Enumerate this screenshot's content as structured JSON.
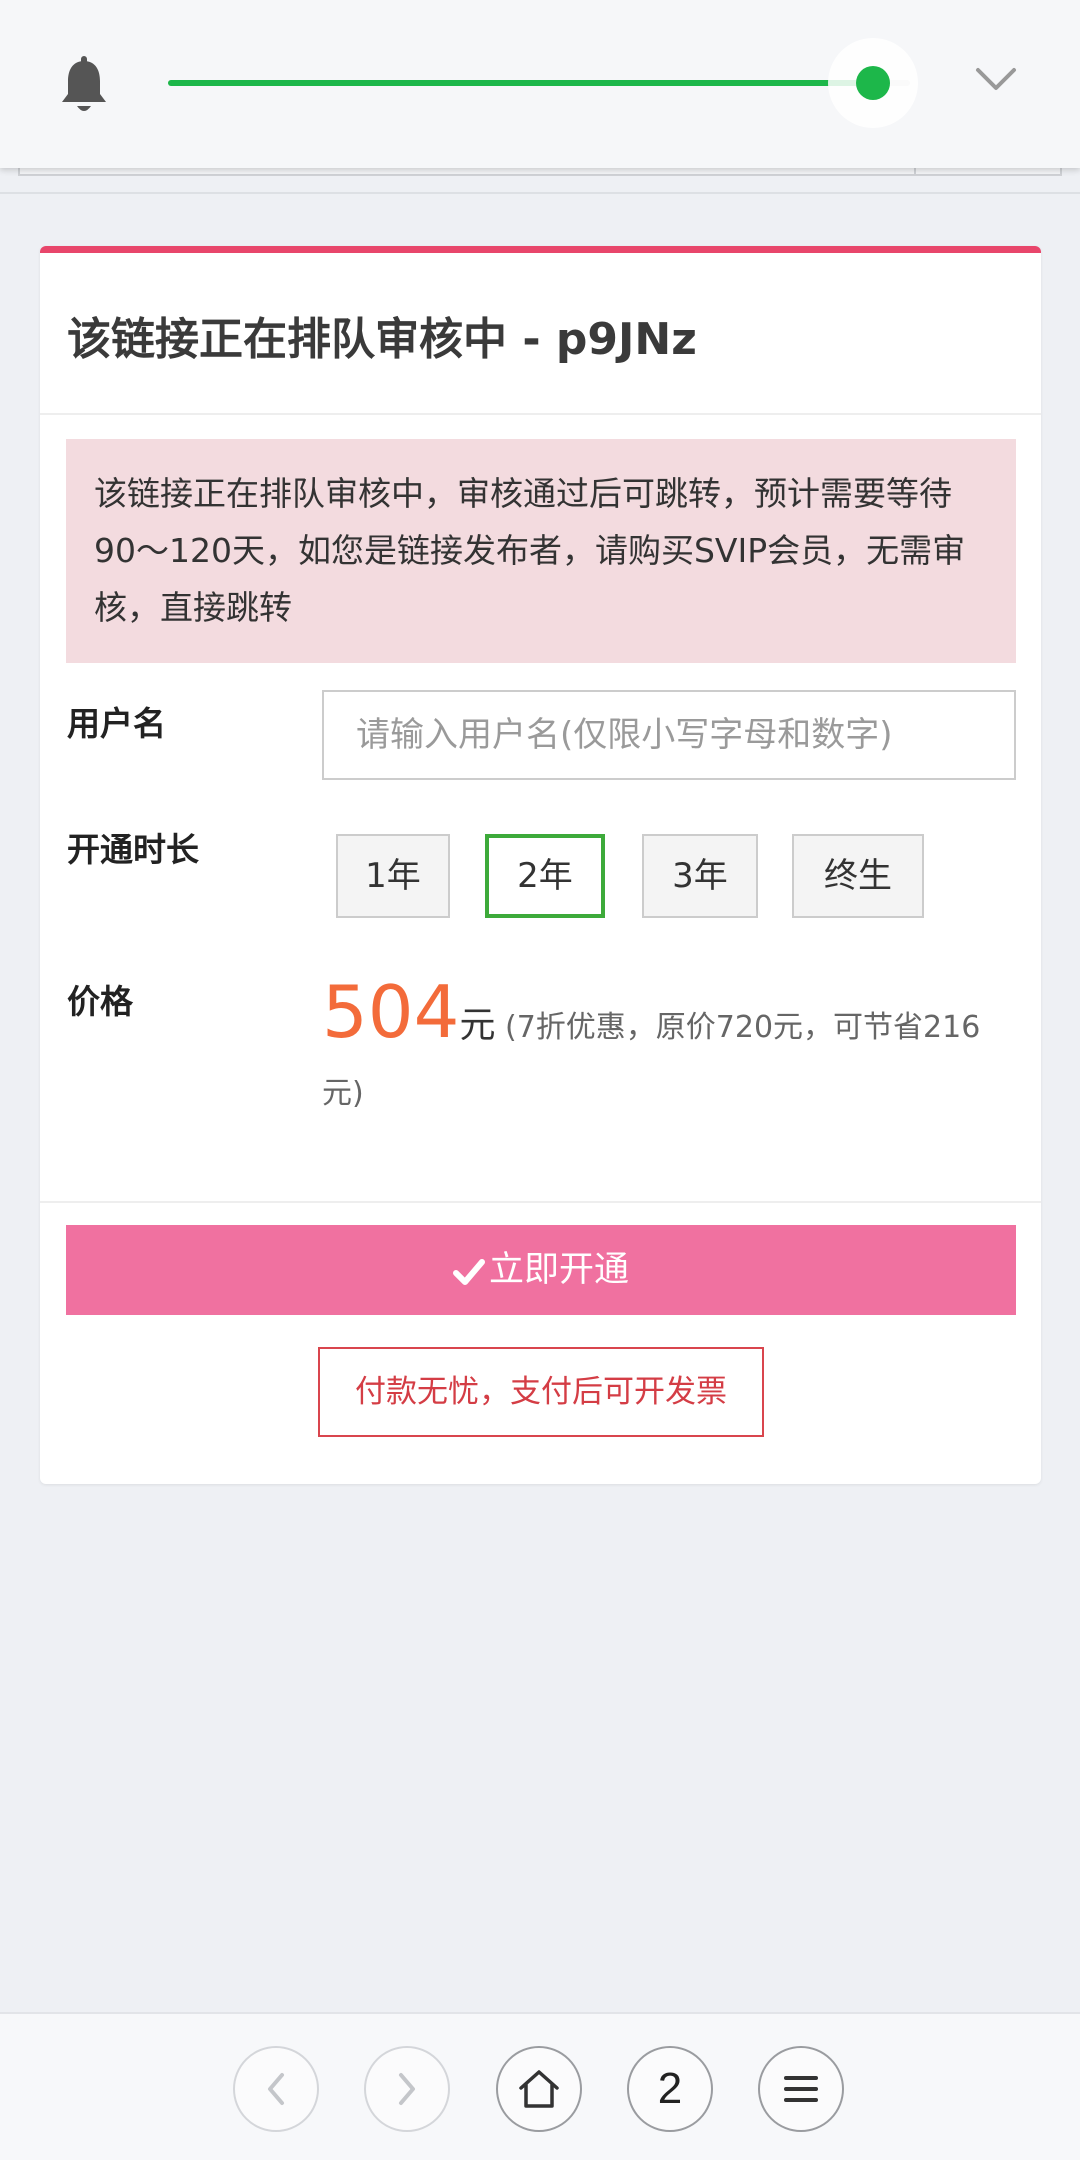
{
  "topbar": {
    "volume_level": 0.95,
    "accent_color": "#1db74a",
    "icons": [
      "bell-icon",
      "chevron-down-icon"
    ]
  },
  "card": {
    "title": "该链接正在排队审核中 - p9JNz",
    "accent_color": "#e8466b",
    "alert_text": "该链接正在排队审核中，审核通过后可跳转，预计需要等待90～120天，如您是链接发布者，请购买SVIP会员，无需审核，直接跳转",
    "form": {
      "username_label": "用户名",
      "username_placeholder": "请输入用户名(仅限小写字母和数字)",
      "username_value": "",
      "duration_label": "开通时长",
      "durations": [
        "1年",
        "2年",
        "3年",
        "终生"
      ],
      "selected_duration": "2年",
      "price_label": "价格",
      "price_value": "504",
      "price_unit": "元",
      "price_note": "(7折优惠，原价720元，可节省216元)"
    },
    "submit_label": "立即开通",
    "notice_text": "付款无忧，支付后可开发票"
  },
  "bottom_nav": {
    "tab_count": "2",
    "icons": [
      "back-icon",
      "forward-icon",
      "home-icon",
      "tabs-count",
      "menu-icon"
    ]
  }
}
